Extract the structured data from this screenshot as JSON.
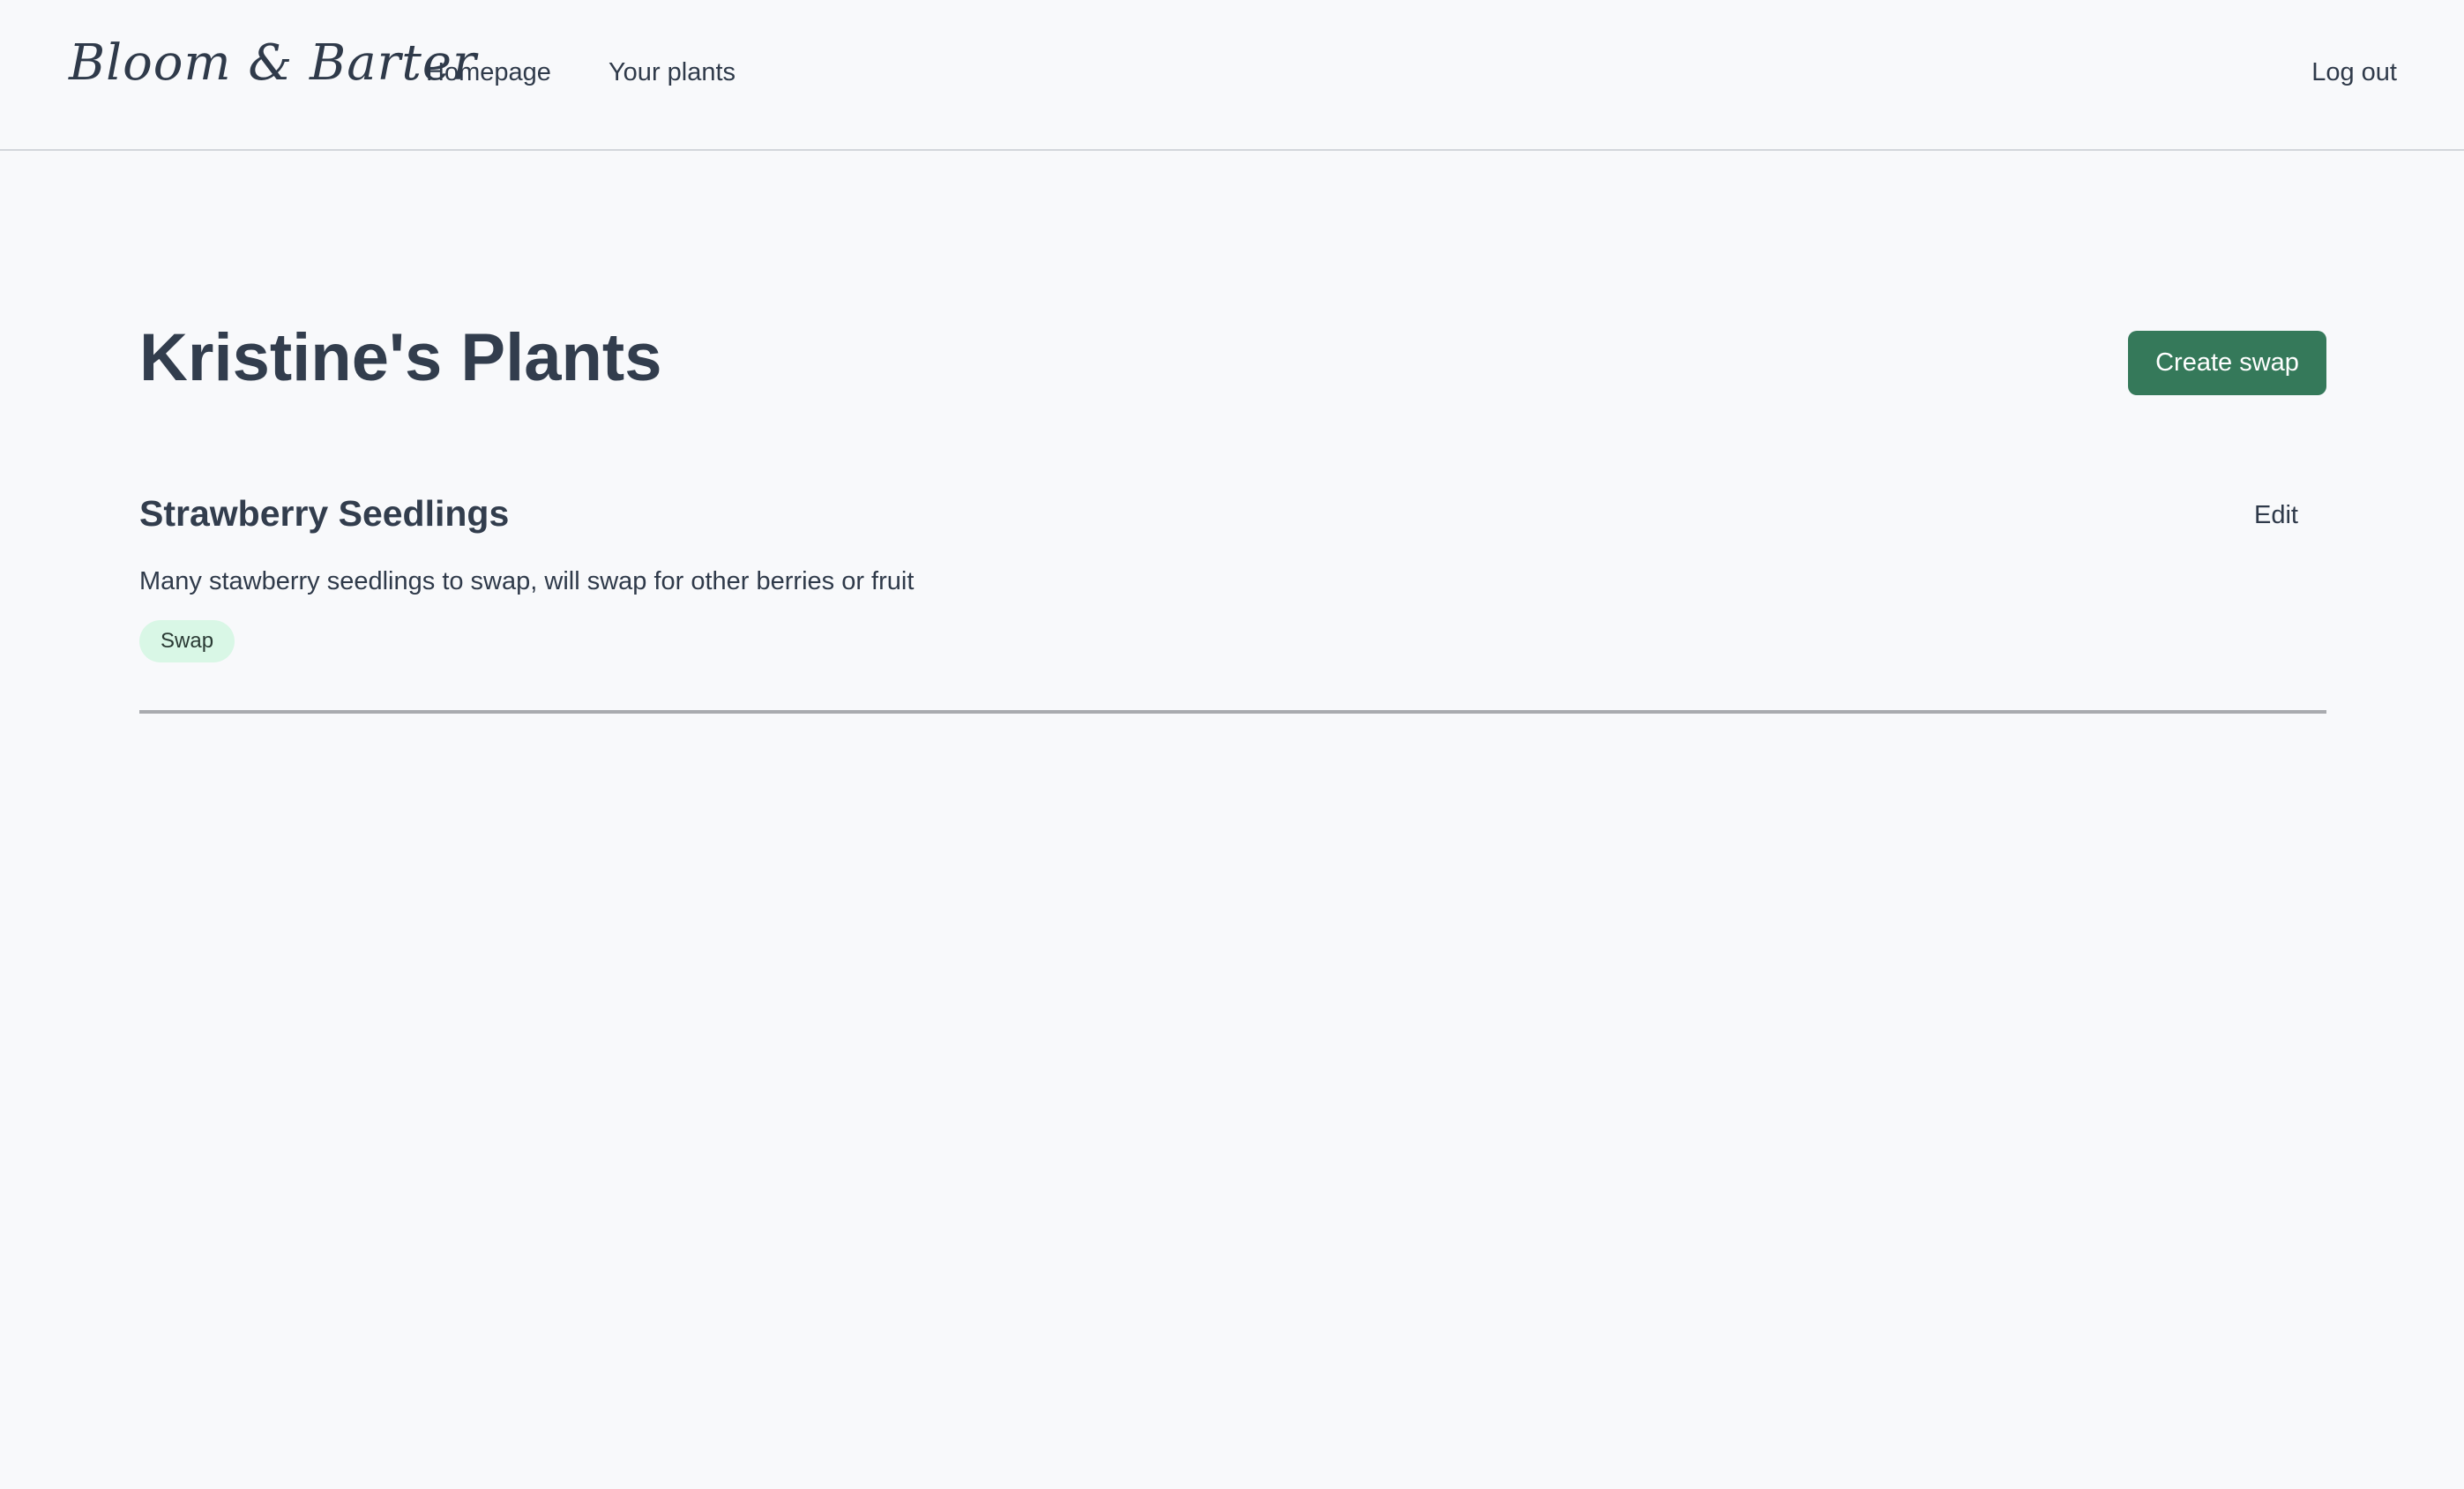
{
  "header": {
    "logo_text": "Bloom & Barter",
    "nav": {
      "homepage": "Homepage",
      "your_plants": "Your plants"
    },
    "logout_label": "Log out"
  },
  "main": {
    "title": "Kristine's Plants",
    "create_button_label": "Create swap",
    "plants": [
      {
        "name": "Strawberry Seedlings",
        "edit_label": "Edit",
        "description": "Many stawberry seedlings to swap, will swap for other berries or fruit",
        "tag": "Swap"
      }
    ]
  },
  "colors": {
    "background": "#f8f9fb",
    "primary_button": "#35795a",
    "tag_background": "#d9f7e6",
    "text": "#2f3a4a"
  }
}
